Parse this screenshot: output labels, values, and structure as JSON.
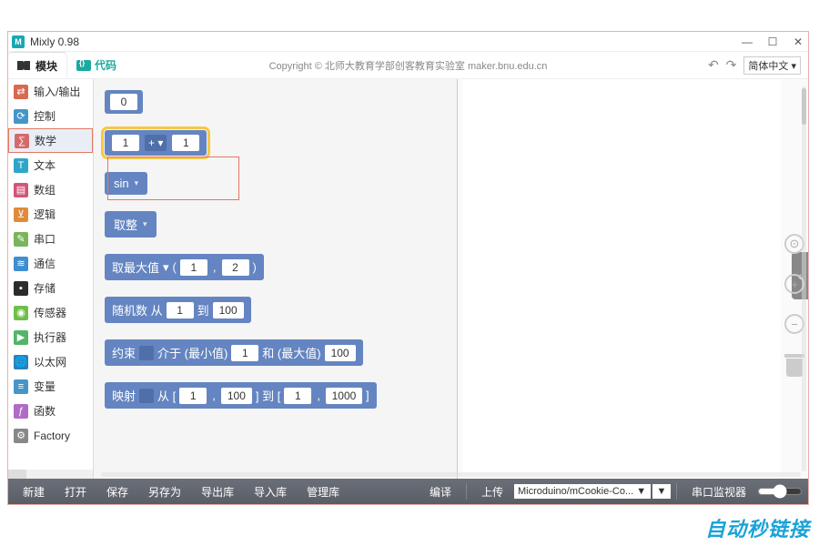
{
  "window": {
    "title": "Mixly 0.98",
    "min": "—",
    "max": "☐",
    "close": "✕"
  },
  "header": {
    "modules_tab": "模块",
    "code_tab": "代码",
    "copyright": "Copyright © 北师大教育学部创客教育实验室 maker.bnu.edu.cn",
    "undo_icon": "↶",
    "redo_icon": "↷",
    "language": "简体中文",
    "lang_dd": "▾"
  },
  "sidebar": {
    "items": [
      {
        "label": "输入/输出",
        "iconColor": "#d9694f",
        "icon": "⇄"
      },
      {
        "label": "控制",
        "iconColor": "#4596c7",
        "icon": "⟳"
      },
      {
        "label": "数学",
        "iconColor": "#d66a6a",
        "icon": "∑",
        "selected": true
      },
      {
        "label": "文本",
        "iconColor": "#2fa6c9",
        "icon": "T"
      },
      {
        "label": "数组",
        "iconColor": "#d15577",
        "icon": "▤"
      },
      {
        "label": "逻辑",
        "iconColor": "#e08a3c",
        "icon": "⊻"
      },
      {
        "label": "串口",
        "iconColor": "#7ab55c",
        "icon": "✎"
      },
      {
        "label": "通信",
        "iconColor": "#3e8ed0",
        "icon": "≋"
      },
      {
        "label": "存储",
        "iconColor": "#2b2b2b",
        "icon": "▪"
      },
      {
        "label": "传感器",
        "iconColor": "#6fbf4a",
        "icon": "◉"
      },
      {
        "label": "执行器",
        "iconColor": "#53b56a",
        "icon": "▶"
      },
      {
        "label": "以太网",
        "iconColor": "#2f7fb6",
        "icon": "🌐"
      },
      {
        "label": "变量",
        "iconColor": "#4596c7",
        "icon": "≡"
      },
      {
        "label": "函数",
        "iconColor": "#b06bc7",
        "icon": "ƒ"
      },
      {
        "label": "Factory",
        "iconColor": "#888",
        "icon": "⚙"
      }
    ]
  },
  "blocks": {
    "num0": "0",
    "math_a": "1",
    "math_op": "+",
    "math_b": "1",
    "sin": "sin",
    "floor": "取整",
    "max_label": "取最大值",
    "max_a": "1",
    "max_b": "2",
    "rand_label1": "随机数 从",
    "rand_a": "1",
    "rand_label2": "到",
    "rand_b": "100",
    "constrain_label": "约束",
    "constrain_mid": "介于 (最小值)",
    "constrain_a": "1",
    "constrain_and": "和 (最大值)",
    "constrain_b": "100",
    "map_label": "映射",
    "map_from": "从 [",
    "map_a": "1",
    "map_b": "100",
    "map_to": "] 到 [",
    "map_c": "1",
    "map_d": "1000",
    "map_end": "]",
    "dd": "▾"
  },
  "rail": {
    "chevron": "‹",
    "target": "⊙",
    "plus": "+",
    "minus": "−"
  },
  "toolbar": {
    "new": "新建",
    "open": "打开",
    "save": "保存",
    "saveas": "另存为",
    "export": "导出库",
    "import": "导入库",
    "manage": "管理库",
    "compile": "编译",
    "upload": "上传",
    "board": "Microduino/mCookie-Co...",
    "dd": "▼",
    "monitor": "串口监视器"
  },
  "watermark": "自动秒链接"
}
